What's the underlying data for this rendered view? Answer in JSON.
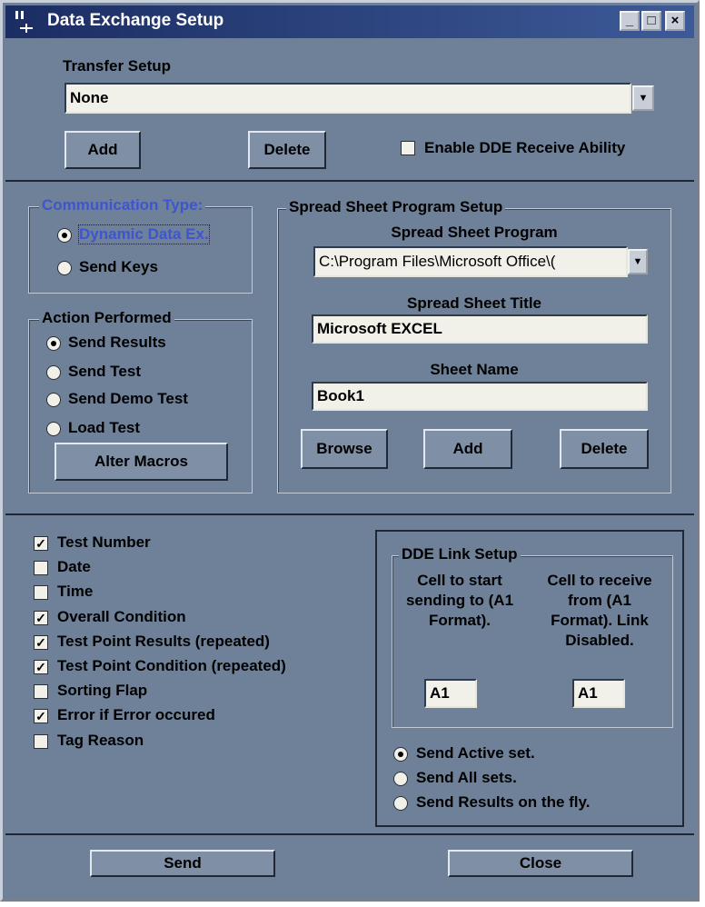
{
  "window": {
    "title": "Data Exchange Setup",
    "minimize": "_",
    "maximize": "□",
    "close": "×"
  },
  "transfer": {
    "label": "Transfer Setup",
    "value": "None",
    "add": "Add",
    "delete": "Delete",
    "enable_dde_label": "Enable DDE Receive Ability",
    "enable_dde_checked": false
  },
  "communication": {
    "title": "Communication Type:",
    "options": [
      {
        "label": "Dynamic Data Ex.",
        "selected": true
      },
      {
        "label": "Send Keys",
        "selected": false
      }
    ]
  },
  "action": {
    "title": "Action Performed",
    "options": [
      {
        "label": "Send Results",
        "selected": true
      },
      {
        "label": "Send Test",
        "selected": false
      },
      {
        "label": "Send Demo Test",
        "selected": false
      },
      {
        "label": "Load Test",
        "selected": false
      }
    ],
    "alter_macros": "Alter Macros"
  },
  "spreadsheet": {
    "group_title": "Spread Sheet Program Setup",
    "program_label": "Spread Sheet Program",
    "program_value": "C:\\Program Files\\Microsoft Office\\(",
    "title_label": "Spread Sheet Title",
    "title_value": "Microsoft EXCEL",
    "sheet_label": "Sheet Name",
    "sheet_value": "Book1",
    "browse": "Browse",
    "add": "Add",
    "delete": "Delete"
  },
  "fields": [
    {
      "label": "Test Number",
      "checked": true
    },
    {
      "label": "Date",
      "checked": false
    },
    {
      "label": "Time",
      "checked": false
    },
    {
      "label": "Overall Condition",
      "checked": true
    },
    {
      "label": "Test Point Results (repeated)",
      "checked": true
    },
    {
      "label": "Test Point Condition (repeated)",
      "checked": true
    },
    {
      "label": "Sorting Flap",
      "checked": false
    },
    {
      "label": "Error if Error occured",
      "checked": true
    },
    {
      "label": "Tag Reason",
      "checked": false
    }
  ],
  "dde_link": {
    "title": "DDE Link Setup",
    "send_label_lines": [
      "Cell to start",
      "sending to (A1",
      "Format)."
    ],
    "receive_label_lines": [
      "Cell to receive",
      "from (A1",
      "Format).  Link",
      "Disabled."
    ],
    "send_cell": "A1",
    "receive_cell": "A1"
  },
  "send_mode": {
    "options": [
      {
        "label": "Send Active set.",
        "selected": true
      },
      {
        "label": "Send All sets.",
        "selected": false
      },
      {
        "label": "Send Results on the fly.",
        "selected": false
      }
    ]
  },
  "footer": {
    "send": "Send",
    "close": "Close"
  },
  "colors": {
    "title_bar": "#1b2d63",
    "dialog_bg": "#6f8198",
    "highlight_text": "#3d55d0"
  }
}
